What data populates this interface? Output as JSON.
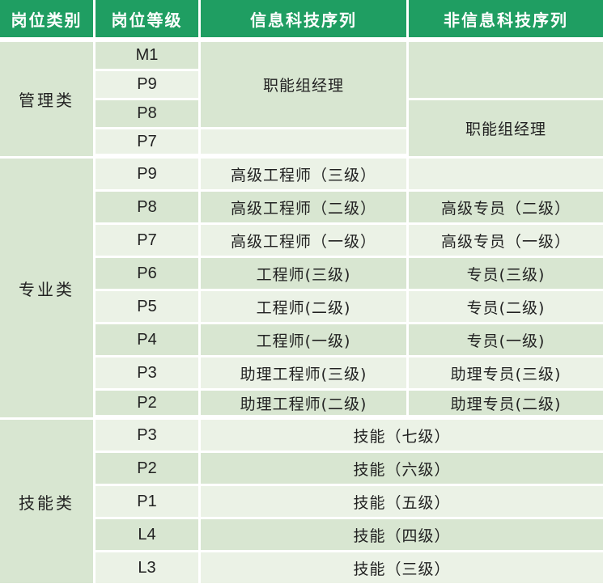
{
  "header": {
    "col1": "岗位类别",
    "col2": "岗位等级",
    "col3": "信息科技序列",
    "col4": "非信息科技序列"
  },
  "management": {
    "category": "管理类",
    "grades": [
      "M1",
      "P9",
      "P8",
      "P7"
    ],
    "it_manager": "职能组经理",
    "non_it_manager": "职能组经理"
  },
  "professional": {
    "category": "专业类",
    "rows": [
      {
        "grade": "P9",
        "it": "高级工程师（三级）",
        "non_it": ""
      },
      {
        "grade": "P8",
        "it": "高级工程师（二级）",
        "non_it": "高级专员（二级）"
      },
      {
        "grade": "P7",
        "it": "高级工程师（一级）",
        "non_it": "高级专员（一级）"
      },
      {
        "grade": "P6",
        "it": "工程师(三级)",
        "non_it": "专员(三级)"
      },
      {
        "grade": "P5",
        "it": "工程师(二级)",
        "non_it": "专员(二级)"
      },
      {
        "grade": "P4",
        "it": "工程师(一级)",
        "non_it": "专员(一级)"
      },
      {
        "grade": "P3",
        "it": "助理工程师(三级)",
        "non_it": "助理专员(三级)"
      },
      {
        "grade": "P2",
        "it": "助理工程师(二级)",
        "non_it": "助理专员(二级)"
      }
    ]
  },
  "skill": {
    "category": "技能类",
    "rows": [
      {
        "grade": "P3",
        "title": "技能（七级）"
      },
      {
        "grade": "P2",
        "title": "技能（六级）"
      },
      {
        "grade": "P1",
        "title": "技能（五级）"
      },
      {
        "grade": "L4",
        "title": "技能（四级）"
      },
      {
        "grade": "L3",
        "title": "技能（三级）"
      }
    ]
  }
}
